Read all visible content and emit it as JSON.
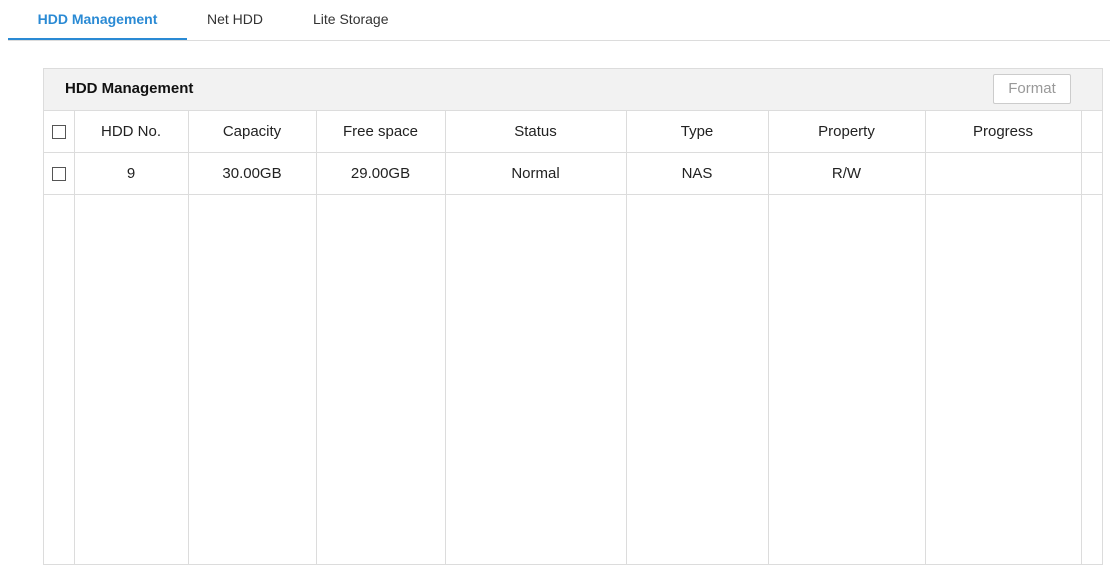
{
  "tabs": [
    {
      "label": "HDD Management",
      "active": true
    },
    {
      "label": "Net HDD",
      "active": false
    },
    {
      "label": "Lite Storage",
      "active": false
    }
  ],
  "panel": {
    "title": "HDD Management",
    "format_label": "Format",
    "format_disabled": true
  },
  "table": {
    "columns": [
      "HDD No.",
      "Capacity",
      "Free space",
      "Status",
      "Type",
      "Property",
      "Progress",
      ""
    ],
    "rows": [
      {
        "hdd_no": "9",
        "capacity": "30.00GB",
        "free_space": "29.00GB",
        "status": "Normal",
        "type": "NAS",
        "property": "R/W",
        "progress": ""
      }
    ]
  },
  "colors": {
    "accent": "#2a8ad4",
    "border": "#dcdcdc",
    "header_bg": "#f2f2f2",
    "disabled_text": "#999999"
  }
}
